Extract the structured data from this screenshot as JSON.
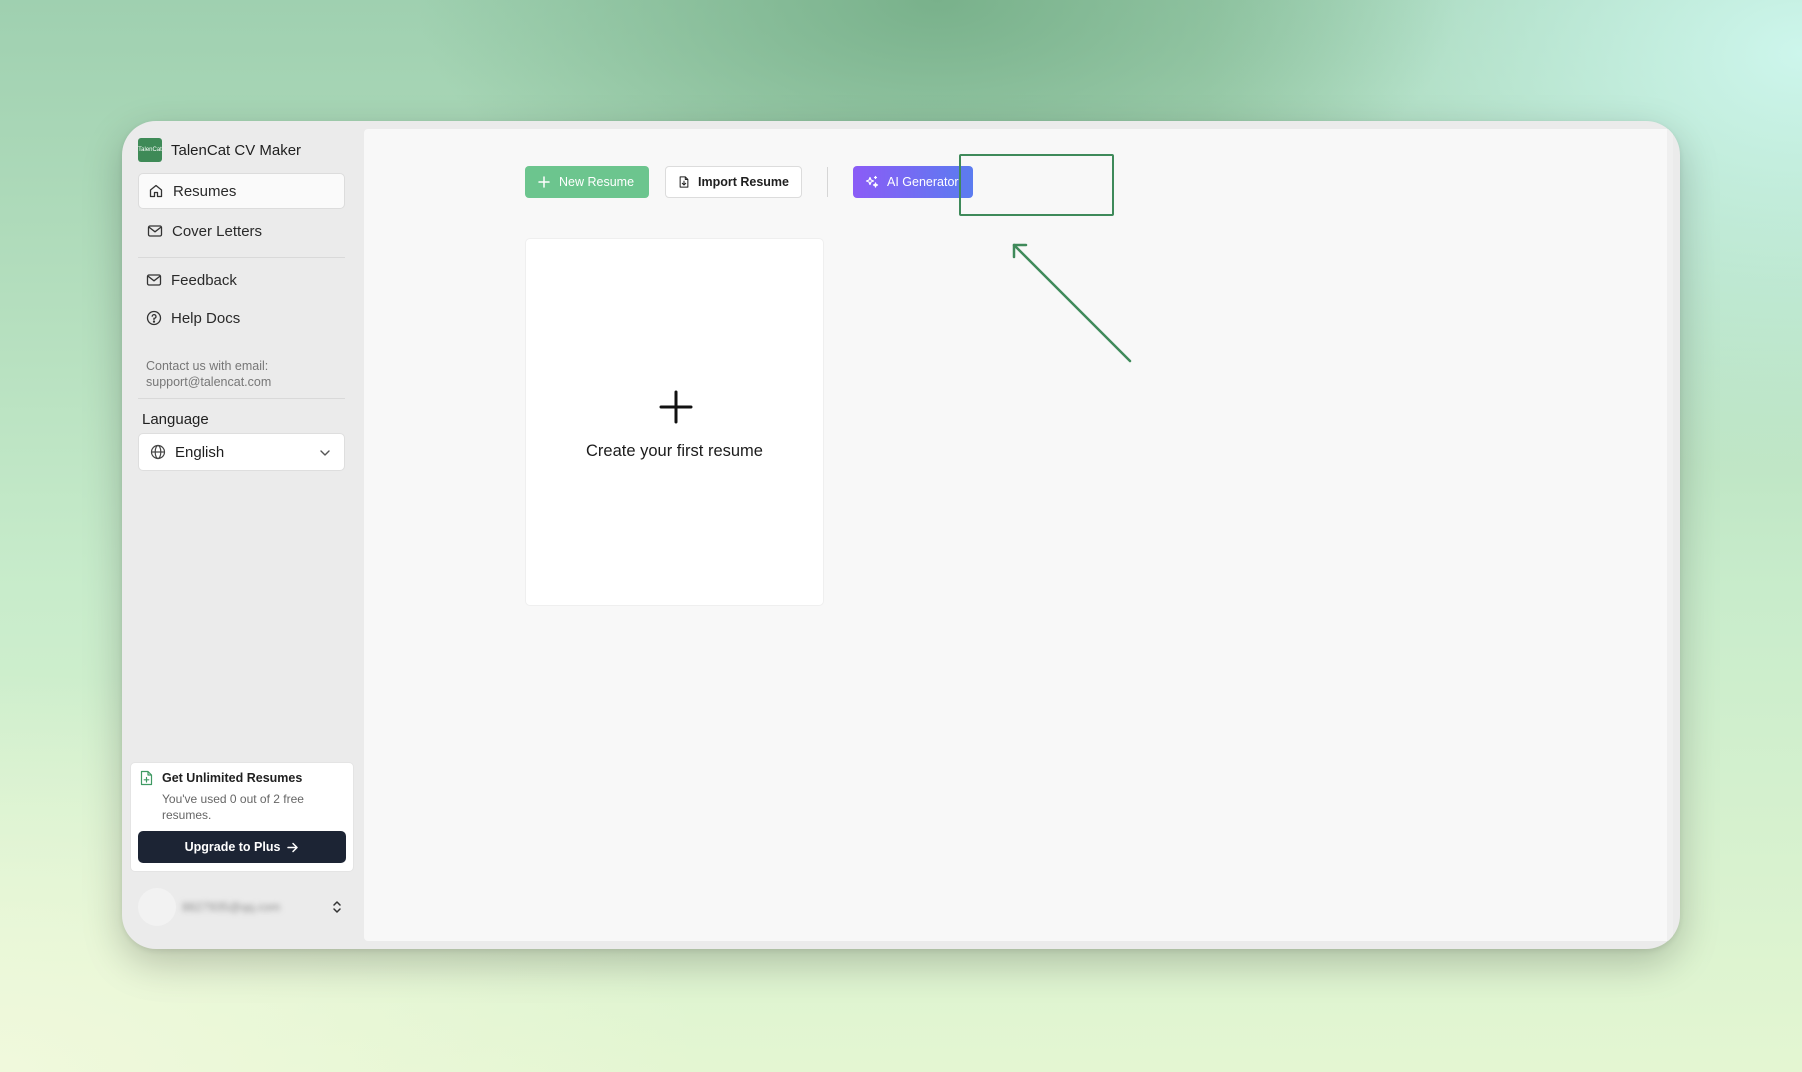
{
  "app": {
    "name": "TalenCat CV Maker",
    "logo_text": "TalenCat"
  },
  "sidebar": {
    "nav": [
      {
        "label": "Resumes",
        "active": true
      },
      {
        "label": "Cover Letters"
      }
    ],
    "secondary": [
      {
        "label": "Feedback"
      },
      {
        "label": "Help Docs"
      }
    ],
    "contact_line1": "Contact us with email:",
    "contact_line2": "support@talencat.com",
    "language_label": "Language",
    "language_value": "English",
    "upgrade": {
      "title": "Get Unlimited Resumes",
      "description": "You've used 0 out of 2 free resumes.",
      "button_label": "Upgrade to Plus"
    },
    "user_email": "8827935@qq.com"
  },
  "toolbar": {
    "new_label": "New Resume",
    "import_label": "Import Resume",
    "ai_label": "AI Generator"
  },
  "main": {
    "create_label": "Create your first resume"
  },
  "colors": {
    "accent_green": "#6cc58e",
    "highlight_green": "#3f8a5a",
    "ai_gradient_start": "#8b5cf6",
    "ai_gradient_end": "#5b7cf0",
    "upgrade_button": "#1c2434"
  }
}
